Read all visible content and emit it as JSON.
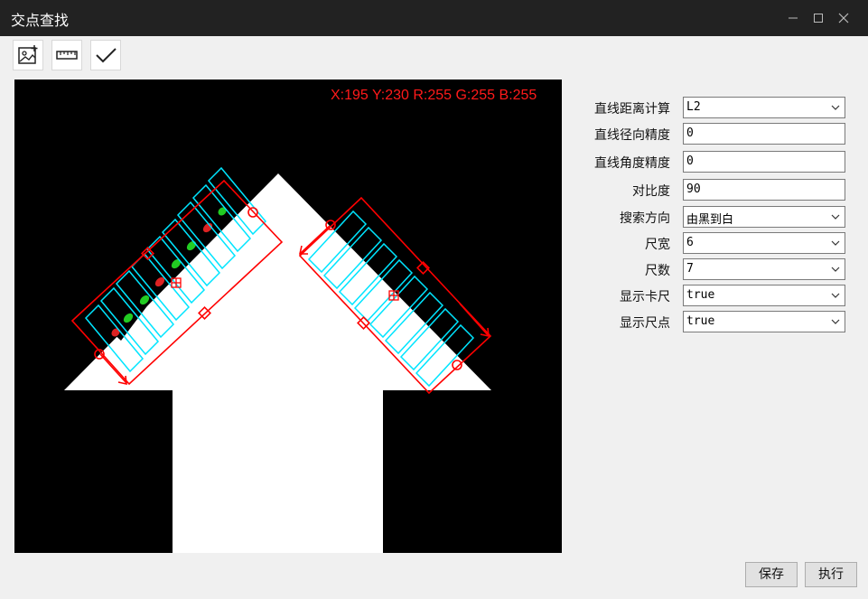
{
  "window": {
    "title": "交点查找"
  },
  "toolbar": {
    "items": [
      "add-image-icon",
      "ruler-icon",
      "checkmark-icon"
    ]
  },
  "viewer": {
    "readout": "X:195 Y:230  R:255 G:255 B:255"
  },
  "params": [
    {
      "label": "直线距离计算",
      "value": "L2",
      "type": "select"
    },
    {
      "label": "直线径向精度",
      "value": "0",
      "type": "input"
    },
    {
      "label": "直线角度精度",
      "value": "0",
      "type": "input"
    },
    {
      "label": "对比度",
      "value": "90",
      "type": "input"
    },
    {
      "label": "搜索方向",
      "value": "由黑到白",
      "type": "select"
    },
    {
      "label": "尺宽",
      "value": "6",
      "type": "select"
    },
    {
      "label": "尺数",
      "value": "7",
      "type": "select"
    },
    {
      "label": "显示卡尺",
      "value": "true",
      "type": "select"
    },
    {
      "label": "显示尺点",
      "value": "true",
      "type": "select"
    }
  ],
  "buttons": {
    "save": "保存",
    "run": "执行"
  },
  "colors": {
    "titlebar": "#222222",
    "caliper_frame": "#ff0000",
    "caliper_lines": "#00e5ff",
    "edge_points": "#22cc22"
  }
}
